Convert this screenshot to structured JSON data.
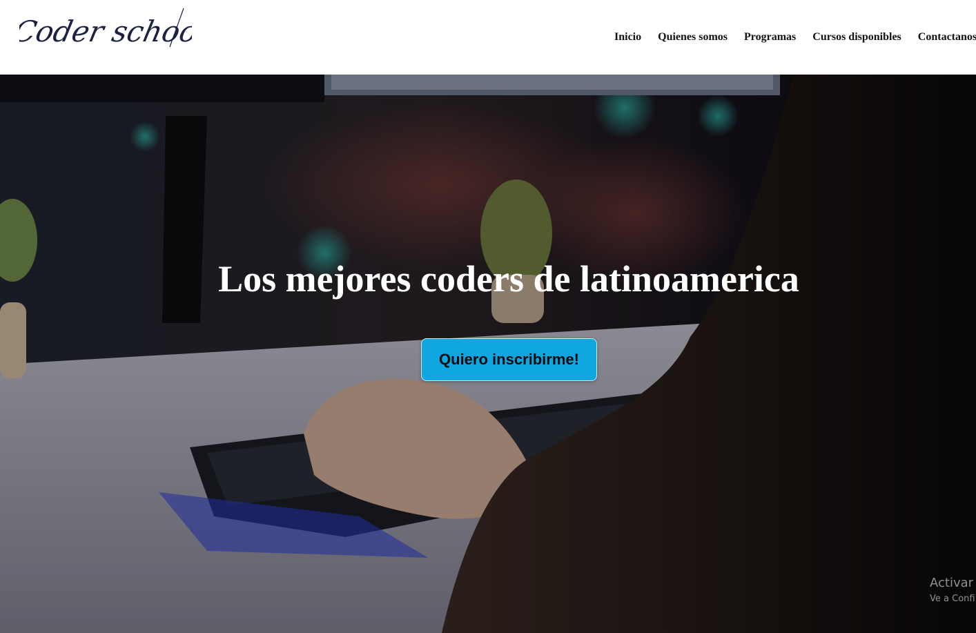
{
  "brand": {
    "logo_text": "Coder school"
  },
  "nav": {
    "items": [
      {
        "label": "Inicio"
      },
      {
        "label": "Quienes somos"
      },
      {
        "label": "Programas"
      },
      {
        "label": "Cursos disponibles"
      },
      {
        "label": "Contactanos"
      }
    ]
  },
  "hero": {
    "title": "Los mejores coders de latinoamerica",
    "cta_label": "Quiero inscribirme!",
    "cta_color": "#10a6e2"
  },
  "watermark": {
    "line1": "Activar",
    "line2": "Ve a Confi"
  }
}
